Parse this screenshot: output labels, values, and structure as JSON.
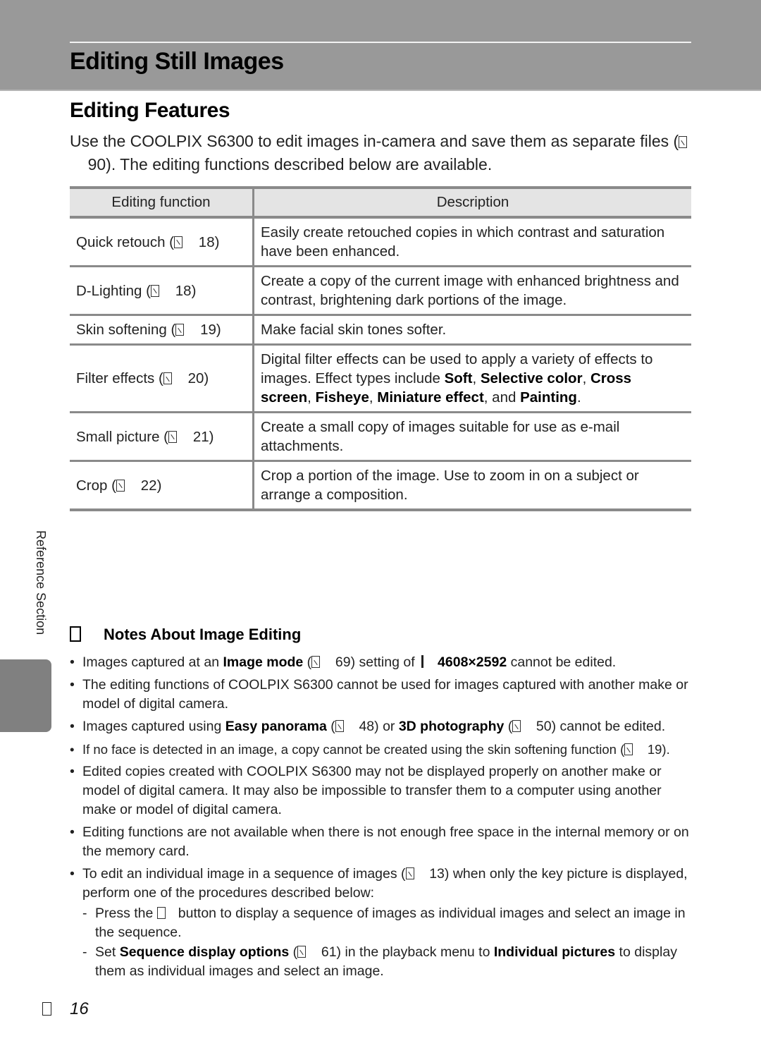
{
  "header": {
    "title": "Editing Still Images"
  },
  "section": {
    "title": "Editing Features",
    "intro_part1": "Use the COOLPIX S6300 to edit images in-camera and save them as separate files (",
    "intro_ref": "90",
    "intro_part2": "). The editing functions described below are available."
  },
  "table": {
    "headers": [
      "Editing function",
      "Description"
    ],
    "rows": [
      {
        "function": "Quick retouch (",
        "ref": "18",
        "desc": "Easily create retouched copies in which contrast and saturation have been enhanced."
      },
      {
        "function": "D-Lighting (",
        "ref": "18",
        "desc": "Create a copy of the current image with enhanced brightness and contrast, brightening dark portions of the image."
      },
      {
        "function": "Skin softening (",
        "ref": "19",
        "desc": "Make facial skin tones softer."
      },
      {
        "function": "Filter effects (",
        "ref": "20",
        "desc_parts": [
          "Digital filter effects can be used to apply a variety of effects to images. Effect types include ",
          "Soft",
          ", ",
          "Selective color",
          ", ",
          "Cross screen",
          ", ",
          "Fisheye",
          ", ",
          "Miniature effect",
          ", and ",
          "Painting",
          "."
        ]
      },
      {
        "function": "Small picture (",
        "ref": "21",
        "desc": "Create a small copy of images suitable for use as e-mail attachments."
      },
      {
        "function": "Crop (",
        "ref": "22",
        "desc": "Crop a portion of the image. Use to zoom in on a subject or arrange a composition."
      }
    ]
  },
  "sidebar": {
    "label": "Reference Section"
  },
  "notes": {
    "title": "Notes About Image Editing",
    "items": [
      {
        "parts": [
          "Images captured at an ",
          "Image mode",
          " (",
          "69",
          ") setting of ",
          "4608×2592",
          " cannot be edited."
        ]
      },
      {
        "text": "The editing functions of COOLPIX S6300 cannot be used for images captured with another make or model of digital camera."
      },
      {
        "parts": [
          "Images captured using ",
          "Easy panorama",
          " (",
          "48",
          ") or ",
          "3D photography",
          " (",
          "50",
          ") cannot be edited."
        ]
      },
      {
        "parts": [
          "If no face is detected in an image, a copy cannot be created using the skin softening function (",
          "19",
          ")."
        ]
      },
      {
        "text": "Edited copies created with COOLPIX S6300 may not be displayed properly on another make or model of digital camera. It may also be impossible to transfer them to a computer using another make or model of digital camera."
      },
      {
        "text": "Editing functions are not available when there is not enough free space in the internal memory or on the memory card."
      },
      {
        "parts": [
          "To edit an individual image in a sequence of images (",
          "13",
          ") when only the key picture is displayed, perform one of the procedures described below:"
        ],
        "subs": [
          {
            "parts": [
              "Press the ",
              "button to display a sequence of images as individual images and select an image in the sequence."
            ]
          },
          {
            "parts": [
              "Set ",
              "Sequence display options",
              " (",
              "61",
              ") in the playback menu to ",
              "Individual pictures",
              " to display them as individual images and select an image."
            ]
          }
        ]
      }
    ]
  },
  "footer": {
    "page_number": "16"
  },
  "colors": {
    "header_band": "#999999",
    "table_rule": "#8a8a8a",
    "table_head_bg": "#e4e4e4",
    "side_tab": "#808080"
  }
}
